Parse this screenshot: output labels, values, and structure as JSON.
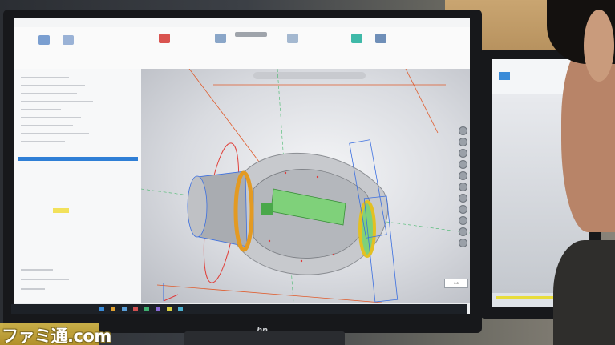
{
  "photo": {
    "subject": "",
    "background_color": "#3a3d42"
  },
  "monitor": {
    "brand_mark": "hp"
  },
  "cad_app": {
    "accent": "#2f7fd6",
    "viewport": {
      "coordinate_readout": "0.0"
    }
  },
  "watermark": {
    "text": "ファミ通.com"
  }
}
